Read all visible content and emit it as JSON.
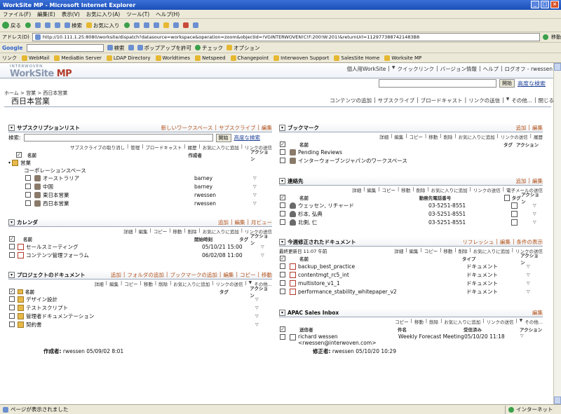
{
  "window": {
    "title": "WorkSite MP - Microsoft Internet Explorer"
  },
  "menu": [
    "ファイル(F)",
    "編集(E)",
    "表示(V)",
    "お気に入り(A)",
    "ツール(T)",
    "ヘルプ(H)"
  ],
  "toolbar": {
    "back": "戻る",
    "search": "検索",
    "favorites": "お気に入り"
  },
  "address": {
    "label": "アドレス(D)",
    "url": "http://10.111.1.25:8080/worksite/dispatch?datasource=workspace&operation=zoom&objectId=!VGINTERWOVEN!C!F:200!W:201!&returnUrl=1129773887421483B8",
    "go": "移動"
  },
  "googlebar": {
    "brand": "Google",
    "search": "検索",
    "popup": "ポップアップを許可",
    "check": "チェック",
    "options": "オプション"
  },
  "links": {
    "label": "リンク",
    "items": [
      "WebMail",
      "MediaBin Server",
      "LDAP Directory",
      "Worldtimes",
      "Netspeed",
      "Changepoint",
      "Interwoven Support",
      "SalesSite Home",
      "Worksite MP"
    ]
  },
  "app": {
    "brand_small": "INTERWOVEN",
    "brand_a": "WorkSite",
    "brand_b": " MP"
  },
  "topnav": [
    "個人用WorkSite",
    "クイックリンク",
    "バージョン情報",
    "ヘルプ",
    "ログオフ - rwessen"
  ],
  "search": {
    "button": "開始",
    "advanced": "高度な検索"
  },
  "breadcrumb": "ホーム > 営業 > 西日本営業",
  "page_title": "西日本営業",
  "actions": [
    "コンテンツの追加",
    "サブスクライブ",
    "ブロードキャスト",
    "リンクの送信",
    "その他...",
    "閉じる"
  ],
  "subscriptions": {
    "title": "サブスクリプションリスト",
    "links": [
      "新しいワークスペース",
      "サブスクライブ",
      "編集"
    ],
    "search_label": "検索:",
    "search_btn": "開始",
    "advanced": "高度な検索",
    "toolbar": [
      "サブスクライブの取り消し",
      "管理",
      "ブロードキャスト",
      "履歴",
      "お気に入りに追加",
      "リンクの送信"
    ],
    "columns": [
      "名前",
      "作成者",
      "アクション"
    ],
    "group": "営業",
    "subgroup": "コーポレーションスペース",
    "rows": [
      {
        "name": "オーストラリア",
        "author": "barney"
      },
      {
        "name": "中国",
        "author": "barney"
      },
      {
        "name": "東日本営業",
        "author": "rwessen"
      },
      {
        "name": "西日本営業",
        "author": "rwessen"
      }
    ]
  },
  "calendar": {
    "title": "カレンダ",
    "links": [
      "追加",
      "編集",
      "月ビュー"
    ],
    "toolbar": [
      "詳細",
      "編集",
      "コピー",
      "移動",
      "削除",
      "お気に入りに追加",
      "リンクの送信"
    ],
    "columns": [
      "名前",
      "開始時刻",
      "タグ",
      "アクション"
    ],
    "rows": [
      {
        "name": "セールスミーティング",
        "start": "05/10/21 15:00"
      },
      {
        "name": "コンテンツ管理フォーラム",
        "start": "06/02/08 11:00"
      }
    ]
  },
  "project_docs": {
    "title": "プロジェクトのドキュメント",
    "links": [
      "追加",
      "フォルダの追加",
      "ブックマークの追加",
      "編集",
      "コピー",
      "移動"
    ],
    "toolbar": [
      "詳細",
      "編集",
      "コピー",
      "移動",
      "削除",
      "お気に入りに追加",
      "リンクの送信",
      "その他..."
    ],
    "columns": [
      "名前",
      "タグ",
      "アクション"
    ],
    "rows": [
      "デザイン設計",
      "テストスクリプト",
      "管理者ドキュメンテーション",
      "契約書"
    ]
  },
  "bookmarks": {
    "title": "ブックマーク",
    "links": [
      "追加",
      "編集"
    ],
    "toolbar": [
      "詳細",
      "編集",
      "コピー",
      "移動",
      "削除",
      "お気に入りに追加",
      "リンクの送信",
      "履歴"
    ],
    "columns": [
      "名前",
      "タグ",
      "アクション"
    ],
    "rows": [
      "Pending Reviews",
      "インターウォーブンジャパンのワークスペース"
    ]
  },
  "contacts": {
    "title": "連絡先",
    "links": [
      "追加",
      "編集"
    ],
    "toolbar": [
      "詳細",
      "編集",
      "コピー",
      "移動",
      "削除",
      "お気に入りに追加",
      "リンクの送信",
      "電子メールの送信"
    ],
    "columns": [
      "名前",
      "勤務先電話番号",
      "タグ",
      "アクション"
    ],
    "rows": [
      {
        "name": "ウェッセン, リチャード",
        "phone": "03-5251-8551"
      },
      {
        "name": "杉本, 弘典",
        "phone": "03-5251-8551"
      },
      {
        "name": "北側, 仁",
        "phone": "03-5251-8551"
      }
    ]
  },
  "recent_docs": {
    "title": "今週修正されたドキュメント",
    "links": [
      "リフレッシュ",
      "編集",
      "条件の表示"
    ],
    "updated": "最終更新日 11:07 午前",
    "toolbar": [
      "詳細",
      "編集",
      "コピー",
      "移動",
      "削除",
      "お気に入りに追加",
      "リンクの送信"
    ],
    "columns": [
      "名前",
      "タイプ",
      "アクション"
    ],
    "rows": [
      {
        "name": "backup_best_practice",
        "type": "ドキュメント"
      },
      {
        "name": "contentmgt_rc5_int",
        "type": "ドキュメント"
      },
      {
        "name": "multistore_v1_1",
        "type": "ドキュメント"
      },
      {
        "name": "performance_stability_whitepaper_v2",
        "type": "ドキュメント"
      }
    ]
  },
  "inbox": {
    "title": "APAC Sales Inbox",
    "links": [
      "編集"
    ],
    "toolbar": [
      "コピー",
      "移動",
      "削除",
      "お気に入りに追加",
      "リンクの送信",
      "その他..."
    ],
    "columns": [
      "送信者",
      "件名",
      "受信済み",
      "アクション"
    ],
    "rows": [
      {
        "sender": "richard wessen",
        "email": "<rwessen@interwoven.com>",
        "subject": "Weekly Forecast Meeting",
        "received": "05/10/20 11:18"
      }
    ]
  },
  "footer": {
    "creator_label": "作成者:",
    "creator": "rwessen  05/09/02 8:01",
    "modifier_label": "修正者:",
    "modifier": "rwessen  05/10/20 10:29"
  },
  "status": {
    "text": "ページが表示されました",
    "zone": "インターネット"
  }
}
